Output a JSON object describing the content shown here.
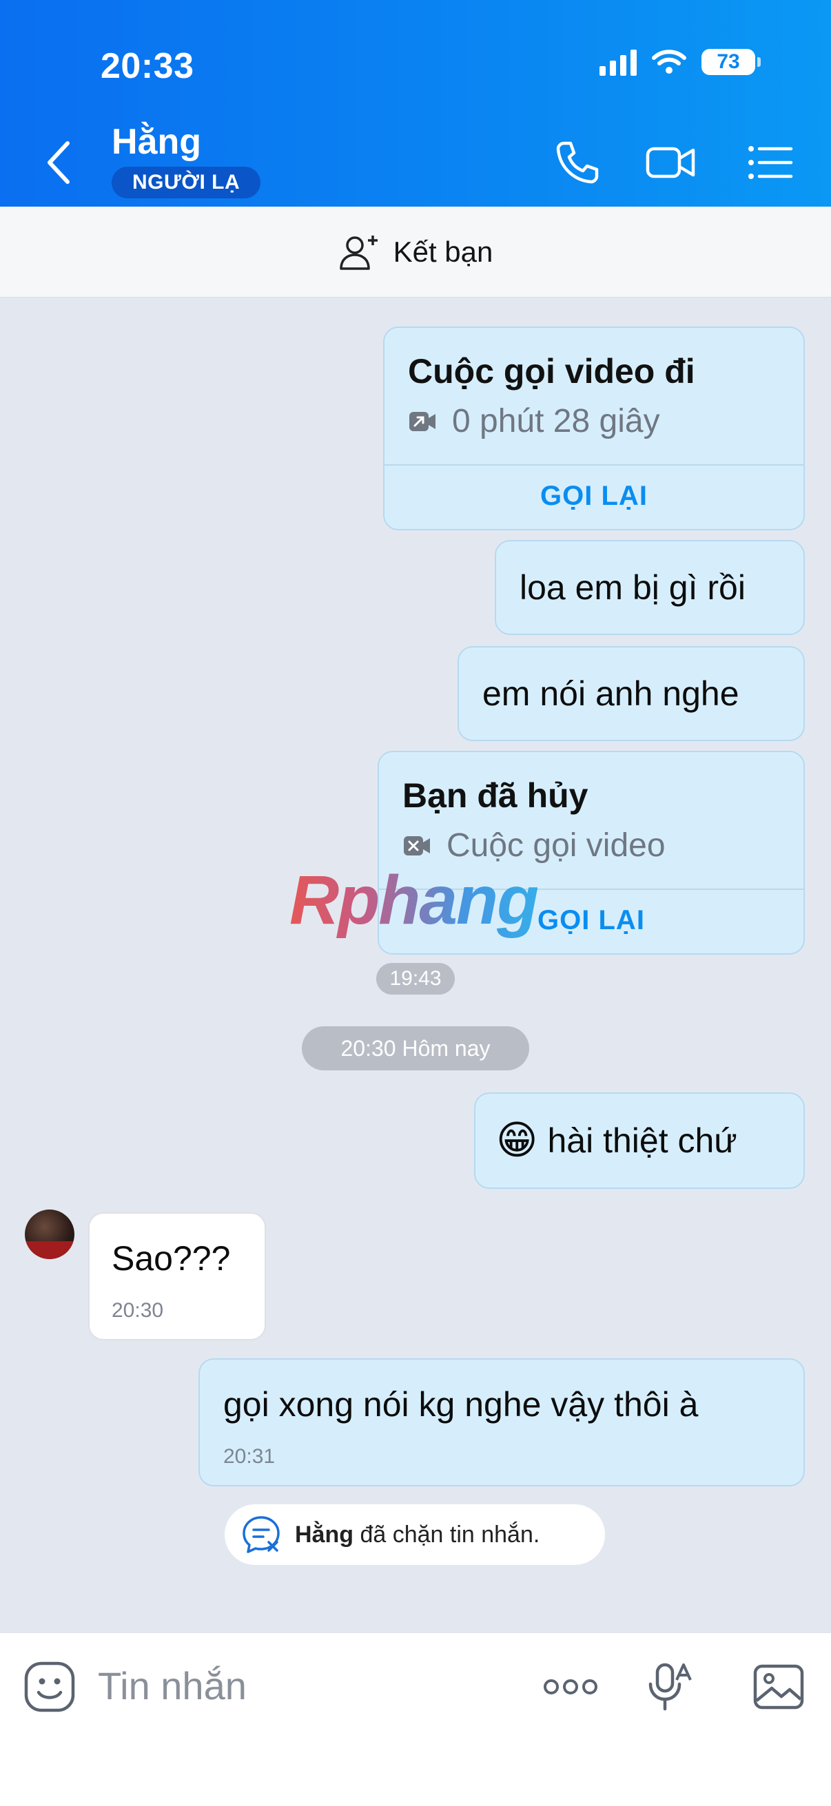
{
  "status_bar": {
    "time": "20:33",
    "battery": "73"
  },
  "header": {
    "contact_name": "Hằng",
    "badge": "NGƯỜI LẠ",
    "icons": [
      "back-arrow-icon",
      "phone-icon",
      "video-camera-icon",
      "menu-list-icon"
    ]
  },
  "add_friend": {
    "label": "Kết bạn",
    "icon": "add-user-icon"
  },
  "messages": {
    "call1": {
      "title": "Cuộc gọi video đi",
      "subtitle": "0 phút 28 giây",
      "action": "GỌI LẠI"
    },
    "msg1": {
      "text": "loa em bị gì rồi"
    },
    "msg2": {
      "text": "em nói anh nghe"
    },
    "call2": {
      "title": "Bạn đã hủy",
      "subtitle": "Cuộc gọi video",
      "action": "GỌI LẠI",
      "time": "19:43"
    },
    "date_separator": "20:30 Hôm nay",
    "msg3": {
      "emoji": "😁",
      "text": "hài thiệt chứ"
    },
    "msg4": {
      "text": "Sao???",
      "time": "20:30"
    },
    "msg5": {
      "text": "gọi xong nói kg nghe vậy thôi à",
      "time": "20:31"
    }
  },
  "blocked_notice": {
    "name": "Hằng",
    "text": " đã chặn tin nhắn."
  },
  "watermark": "Rphang",
  "input_bar": {
    "placeholder": "Tin nhắn"
  },
  "colors": {
    "header": "#0a86f2",
    "accent": "#0a8df0",
    "bubble_out": "#d6eefc",
    "background": "#e3e8f0"
  }
}
